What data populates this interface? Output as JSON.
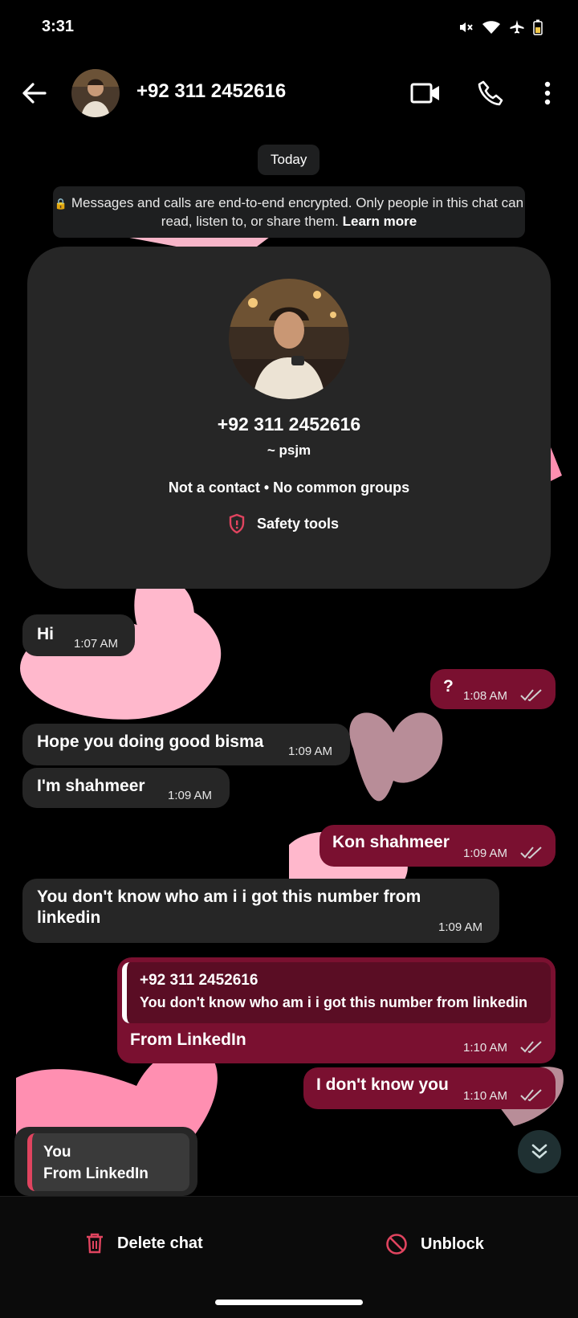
{
  "status_bar": {
    "time": "3:31"
  },
  "header": {
    "contact_title": "+92 311 2452616"
  },
  "chat": {
    "date_chip": "Today",
    "encryption_notice_text": "Messages and calls are end-to-end encrypted. Only people in this chat can read, listen to, or share them.",
    "encryption_learn_more": "Learn more",
    "profile_card": {
      "phone": "+92 311 2452616",
      "alias": "~ psjm",
      "meta": "Not a contact • No common groups",
      "safety_tools": "Safety tools"
    },
    "messages": [
      {
        "dir": "in",
        "text": "Hi",
        "time": "1:07 AM"
      },
      {
        "dir": "out",
        "text": "?",
        "time": "1:08 AM"
      },
      {
        "dir": "in",
        "text": "Hope you doing good bisma",
        "time": "1:09 AM"
      },
      {
        "dir": "in",
        "text": "I'm shahmeer",
        "time": "1:09 AM"
      },
      {
        "dir": "out",
        "text": "Kon shahmeer",
        "time": "1:09 AM"
      },
      {
        "dir": "in",
        "text": "You don't know who am i i got this number from linkedin",
        "time": "1:09 AM"
      },
      {
        "dir": "out",
        "quote_author": "+92 311 2452616",
        "quote_text": "You don't know who am i i got this number from linkedin",
        "text": "From LinkedIn",
        "time": "1:10 AM"
      },
      {
        "dir": "out",
        "text": "I don't know you",
        "time": "1:10 AM"
      }
    ],
    "reply_preview": {
      "author": "You",
      "text": "From LinkedIn"
    }
  },
  "bottom_bar": {
    "delete_label": "Delete chat",
    "unblock_label": "Unblock"
  },
  "colors": {
    "outgoing_bubble": "#7a1030",
    "incoming_bubble": "#262626",
    "accent_red": "#e0445f"
  }
}
